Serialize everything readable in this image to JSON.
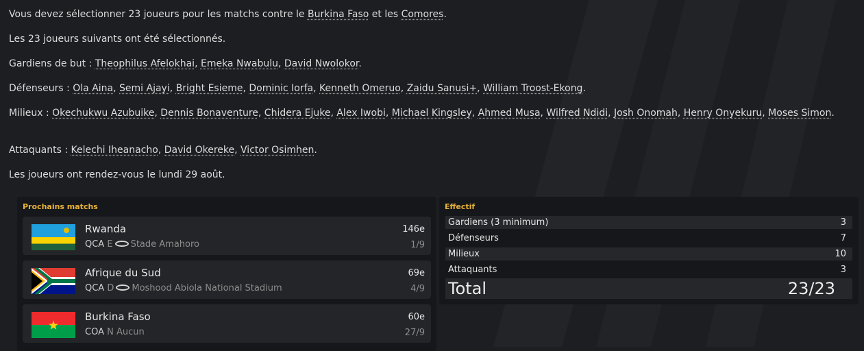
{
  "message": {
    "intro": {
      "text1": "Vous devez sélectionner 23 joueurs pour les matchs contre le ",
      "team1": "Burkina Faso",
      "text2": " et les ",
      "team2": "Comores",
      "text3": "."
    },
    "selected_line": "Les 23 joueurs suivants ont été sélectionnés.",
    "groups": [
      {
        "label": "Gardiens de but : ",
        "players": [
          "Theophilus Afelokhai",
          "Emeka Nwabulu",
          "David Nwolokor"
        ]
      },
      {
        "label": "Défenseurs : ",
        "players": [
          "Ola Aina",
          "Semi Ajayi",
          "Bright Esieme",
          "Dominic Iorfa",
          "Kenneth Omeruo",
          "Zaidu Sanusi+",
          "William Troost-Ekong"
        ]
      },
      {
        "label": "Milieux : ",
        "players": [
          "Okechukwu Azubuike",
          "Dennis Bonaventure",
          "Chidera Ejuke",
          "Alex Iwobi",
          "Michael Kingsley",
          "Ahmed Musa",
          "Wilfred Ndidi",
          "Josh Onomah",
          "Henry Onyekuru",
          "Moses Simon"
        ]
      },
      {
        "label": "Attaquants : ",
        "players": [
          "Kelechi Iheanacho",
          "David Okereke",
          "Victor Osimhen"
        ]
      }
    ],
    "meeting_line": "Les joueurs ont rendez-vous le lundi 29 août."
  },
  "upcoming": {
    "title": "Prochains matchs",
    "matches": [
      {
        "team": "Rwanda",
        "comp": "QCA",
        "venue_type": "E",
        "stadium": "Stade Amahoro",
        "rank": "146e",
        "date": "1/9",
        "flag": "rwanda-flag-icon"
      },
      {
        "team": "Afrique du Sud",
        "comp": "QCA",
        "venue_type": "D",
        "stadium": "Moshood Abiola National Stadium",
        "rank": "69e",
        "date": "4/9",
        "flag": "south-africa-flag-icon"
      },
      {
        "team": "Burkina Faso",
        "comp": "COA",
        "venue_type": "N",
        "stadium": "Aucun",
        "rank": "60e",
        "date": "27/9",
        "flag": "burkina-faso-flag-icon"
      }
    ]
  },
  "squad": {
    "title": "Effectif",
    "rows": [
      {
        "label": "Gardiens (3 minimum)",
        "value": "3"
      },
      {
        "label": "Défenseurs",
        "value": "7"
      },
      {
        "label": "Milieux",
        "value": "10"
      },
      {
        "label": "Attaquants",
        "value": "3"
      }
    ],
    "total_label": "Total",
    "total_value": "23/23"
  },
  "colors": {
    "background": "#1d1e22",
    "panel": "#16171a",
    "row": "#242529",
    "accent": "#e7b23a",
    "text": "#dcdcdc"
  }
}
